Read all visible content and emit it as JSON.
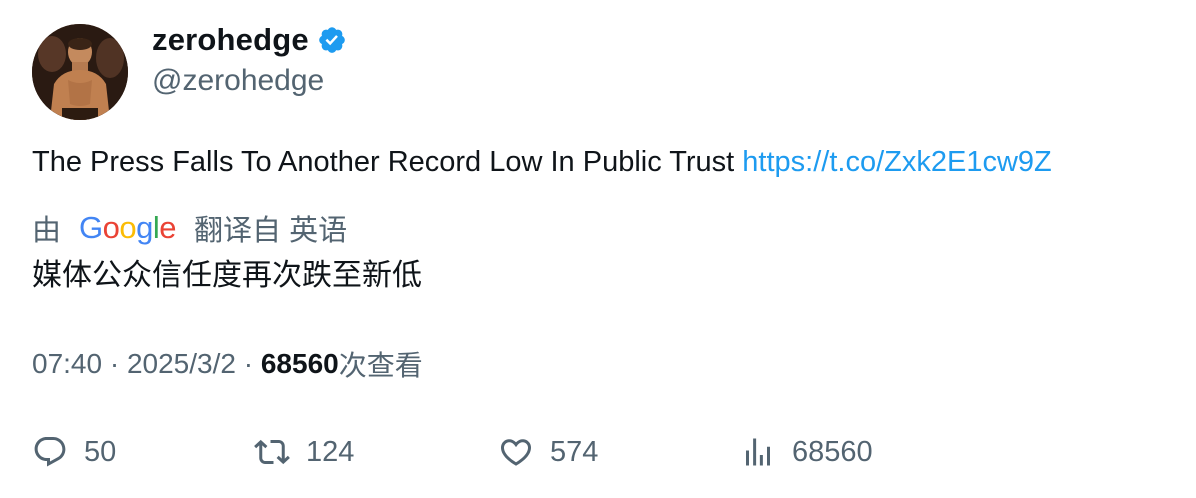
{
  "author": {
    "display_name": "zerohedge",
    "handle": "@zerohedge",
    "verified_icon": "verified-badge-icon",
    "avatar_icon": "profile-avatar"
  },
  "tweet": {
    "text": "The Press Falls To Another Record Low In Public Trust ",
    "link": "https://t.co/Zxk2E1cw9Z"
  },
  "translation": {
    "prefix": "由",
    "provider": "Google",
    "suffix": "翻译自 英语",
    "text": "媒体公众信任度再次跌至新低"
  },
  "meta": {
    "time": "07:40",
    "sep1": " · ",
    "date": "2025/3/2",
    "sep2": " · ",
    "views_count": "68560",
    "views_label": "次查看"
  },
  "actions": {
    "reply_count": "50",
    "retweet_count": "124",
    "like_count": "574",
    "views_count": "68560"
  },
  "colors": {
    "link": "#1d9bf0",
    "secondary_text": "#536471",
    "primary_text": "#0f1419",
    "verified": "#1d9bf0"
  }
}
